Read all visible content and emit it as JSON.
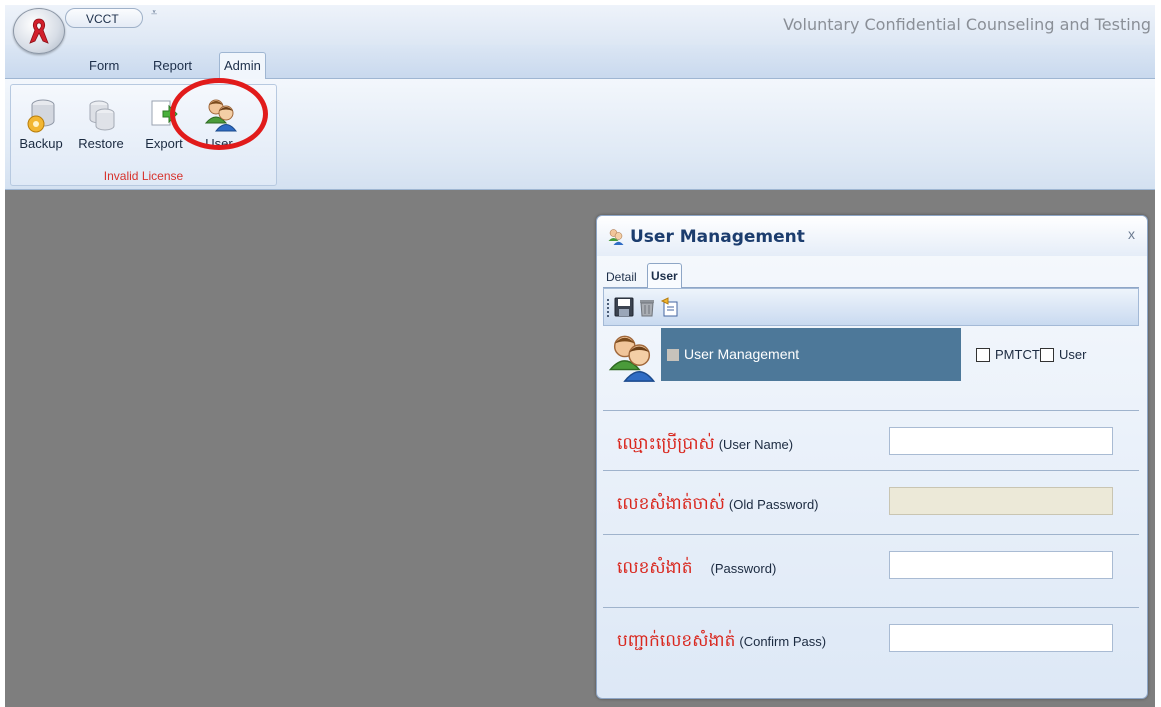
{
  "app": {
    "quick_access_title": "VCCT",
    "quick_access_arrow": "⩡",
    "window_title": "Voluntary Confidential Counseling and Testing"
  },
  "ribbon": {
    "tabs": [
      {
        "label": "Form"
      },
      {
        "label": "Report"
      },
      {
        "label": "Admin",
        "active": true
      }
    ],
    "group": {
      "caption": "Invalid License",
      "buttons": [
        {
          "label": "Backup",
          "icon": "backup-database-icon"
        },
        {
          "label": "Restore",
          "icon": "restore-database-icon"
        },
        {
          "label": "Export",
          "icon": "export-icon"
        },
        {
          "label": "User",
          "icon": "users-icon"
        }
      ]
    }
  },
  "dialog": {
    "title": "User Management",
    "close": "x",
    "tabs": [
      {
        "label": "Detail"
      },
      {
        "label": "User",
        "active": true
      }
    ],
    "toolbar": [
      "save-icon",
      "delete-icon",
      "new-icon"
    ],
    "header": {
      "panel_label": "User Management",
      "checkboxes": [
        {
          "label": "PMTCT",
          "checked": false
        },
        {
          "label": "User",
          "checked": false
        }
      ]
    },
    "fields": [
      {
        "khmer": "ឈ្មោះប្រើប្រាស់",
        "english": "(User Name)",
        "value": "",
        "disabled": false
      },
      {
        "khmer": "លេខសំងាត់ចាស់",
        "english": "(Old Password)",
        "value": "",
        "disabled": true
      },
      {
        "khmer": "លេខសំងាត់",
        "english": "(Password)",
        "value": "",
        "disabled": false
      },
      {
        "khmer": "បញ្ជាក់លេខសំងាត់",
        "english": "(Confirm Pass)",
        "value": "",
        "disabled": false
      }
    ]
  },
  "colors": {
    "accent_red": "#e11b1b",
    "panel_blue": "#4d7899",
    "workspace_gray": "#7e7e7e",
    "khmer_label_red": "#d9271e"
  }
}
